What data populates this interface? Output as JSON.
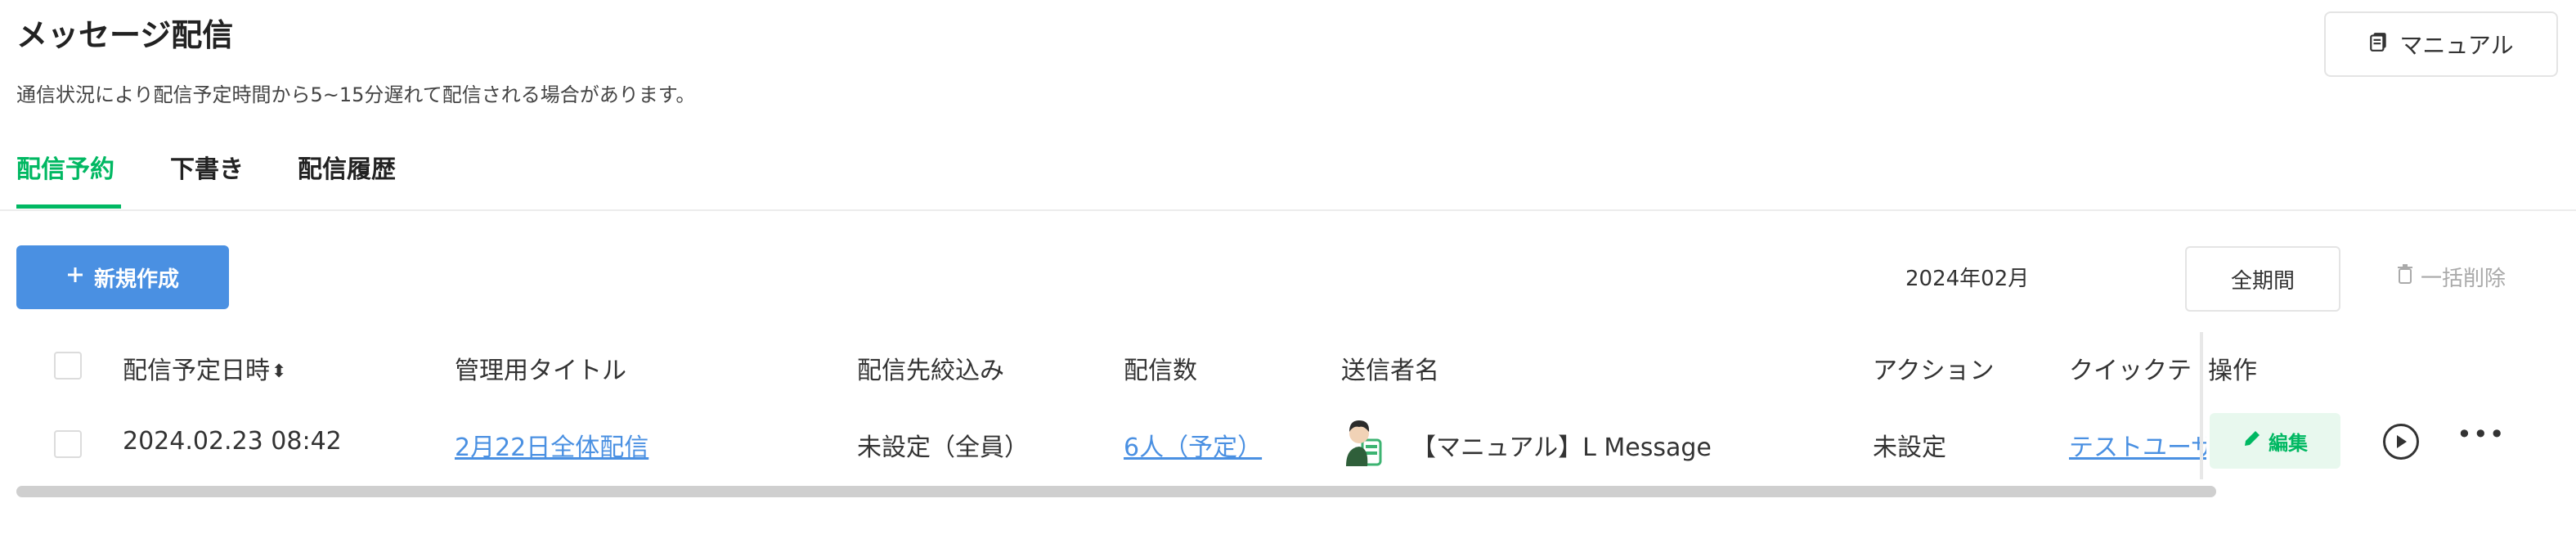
{
  "header": {
    "title": "メッセージ配信",
    "subtitle": "通信状況により配信予定時間から5~15分遅れて配信される場合があります。",
    "manual_label": "マニュアル"
  },
  "tabs": [
    {
      "label": "配信予約",
      "active": true
    },
    {
      "label": "下書き",
      "active": false
    },
    {
      "label": "配信履歴",
      "active": false
    }
  ],
  "toolbar": {
    "new_label": "新規作成",
    "month_filter": "2024年02月",
    "period_label": "全期間",
    "bulk_delete_label": "一括削除"
  },
  "table": {
    "columns": {
      "scheduled": "配信予定日時",
      "title": "管理用タイトル",
      "filter": "配信先絞込み",
      "count": "配信数",
      "sender": "送信者名",
      "action": "アクション",
      "quick": "クイックテ",
      "ops": "操作"
    },
    "rows": [
      {
        "scheduled": "2024.02.23 08:42",
        "title": "2月22日全体配信",
        "filter": "未設定（全員）",
        "count": "6人（予定）",
        "sender": "【マニュアル】L Message",
        "action": "未設定",
        "quick": "テストユーザ",
        "edit_label": "編集"
      }
    ]
  },
  "colors": {
    "accent_green": "#00b862",
    "primary_blue": "#4a90e2"
  }
}
